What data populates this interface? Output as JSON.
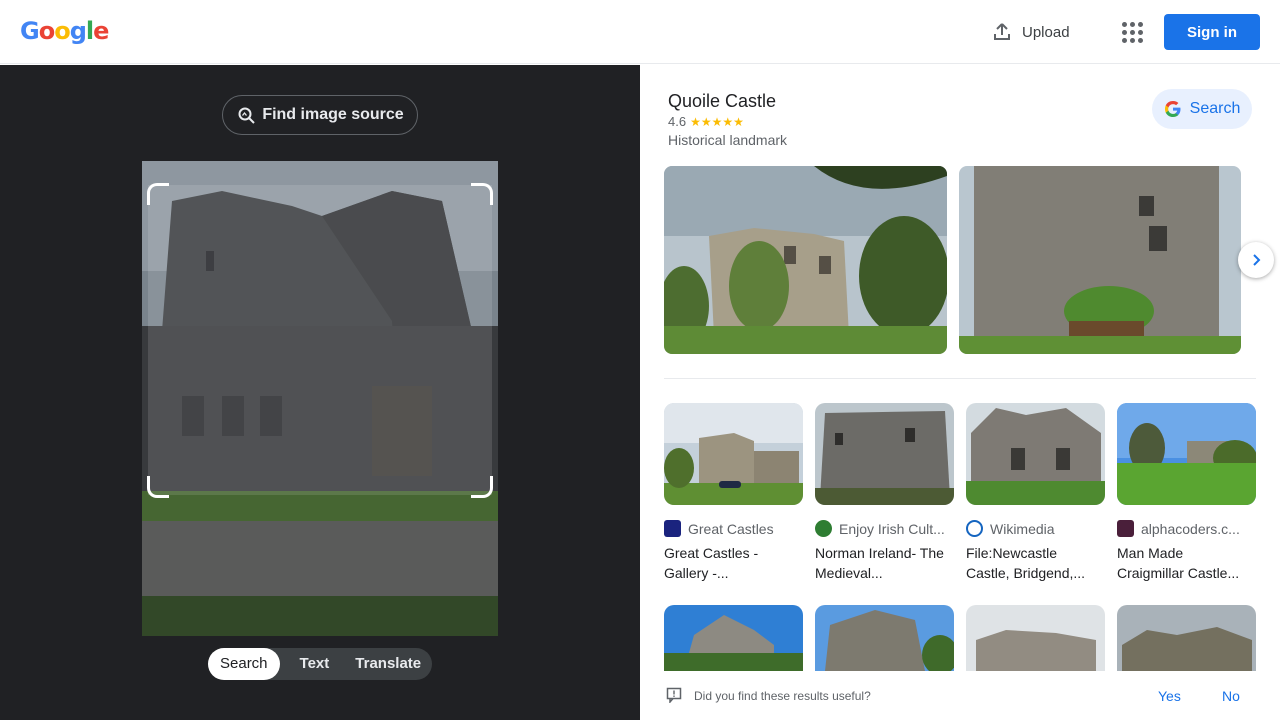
{
  "header": {
    "logo": "Google",
    "upload_label": "Upload",
    "signin_label": "Sign in"
  },
  "lens": {
    "find_source_label": "Find image source",
    "modes": [
      "Search",
      "Text",
      "Translate"
    ],
    "active_mode": "Search"
  },
  "knowledge": {
    "title": "Quoile Castle",
    "rating": "4.6",
    "rating_stars": 4.6,
    "subtitle": "Historical landmark",
    "search_label": "Search"
  },
  "results": [
    {
      "source": "Great Castles",
      "title": "Great Castles - Gallery -..."
    },
    {
      "source": "Enjoy Irish Cult...",
      "title": "Norman Ireland- The Medieval..."
    },
    {
      "source": "Wikimedia",
      "title": "File:Newcastle Castle, Bridgend,..."
    },
    {
      "source": "alphacoders.c...",
      "title": "Man Made Craigmillar Castle..."
    }
  ],
  "feedback": {
    "question": "Did you find these results useful?",
    "yes": "Yes",
    "no": "No"
  },
  "colors": {
    "accent": "#1a73e8",
    "dark_panel": "#202124",
    "star": "#fbbc04"
  }
}
